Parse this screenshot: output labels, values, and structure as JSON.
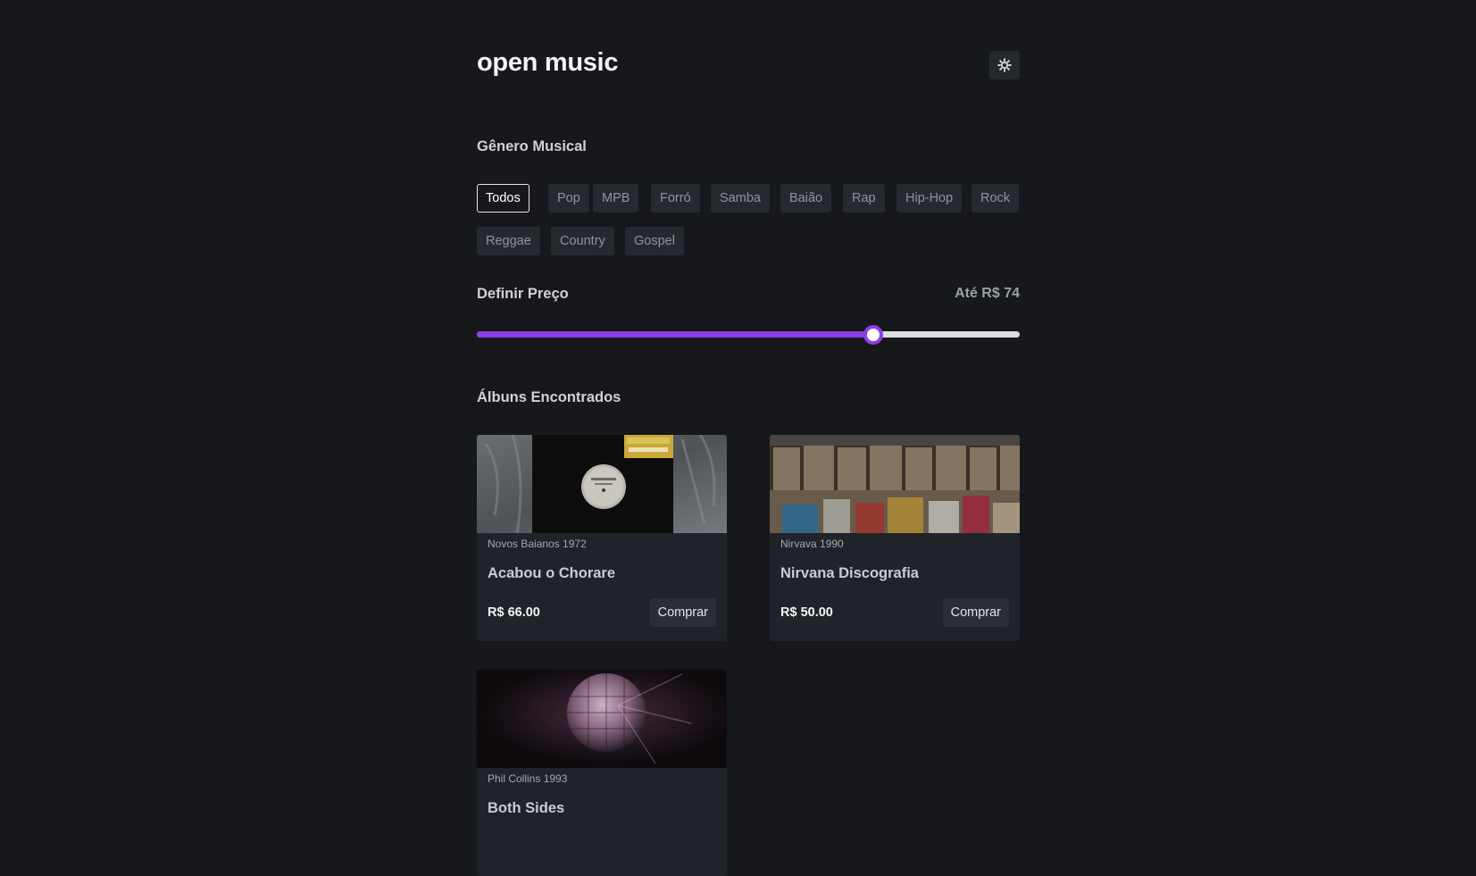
{
  "header": {
    "title": "open music",
    "theme_icon": "gear-icon"
  },
  "genres": {
    "title": "Gênero Musical",
    "items": [
      "Todos",
      "Pop",
      "MPB",
      "Forró",
      "Samba",
      "Baião",
      "Rap",
      "Hip-Hop",
      "Rock",
      "Reggae",
      "Country",
      "Gospel"
    ],
    "selected": "Todos"
  },
  "price": {
    "title": "Definir Preço",
    "label": "Até R$ 74",
    "value_fraction": 0.73
  },
  "albums": {
    "title": "Álbuns Encontrados",
    "items": [
      {
        "meta": "Novos Baianos 1972",
        "title": "Acabou o Chorare",
        "price": "R$ 66.00",
        "buy_label": "Comprar"
      },
      {
        "meta": "Nirvava 1990",
        "title": "Nirvana Discografia",
        "price": "R$ 50.00",
        "buy_label": "Comprar"
      },
      {
        "meta": "Phil Collins 1993",
        "title": "Both Sides",
        "price": "",
        "buy_label": ""
      }
    ]
  },
  "colors": {
    "background": "#16181c",
    "accent": "#8b3fe6",
    "card": "#202329"
  }
}
